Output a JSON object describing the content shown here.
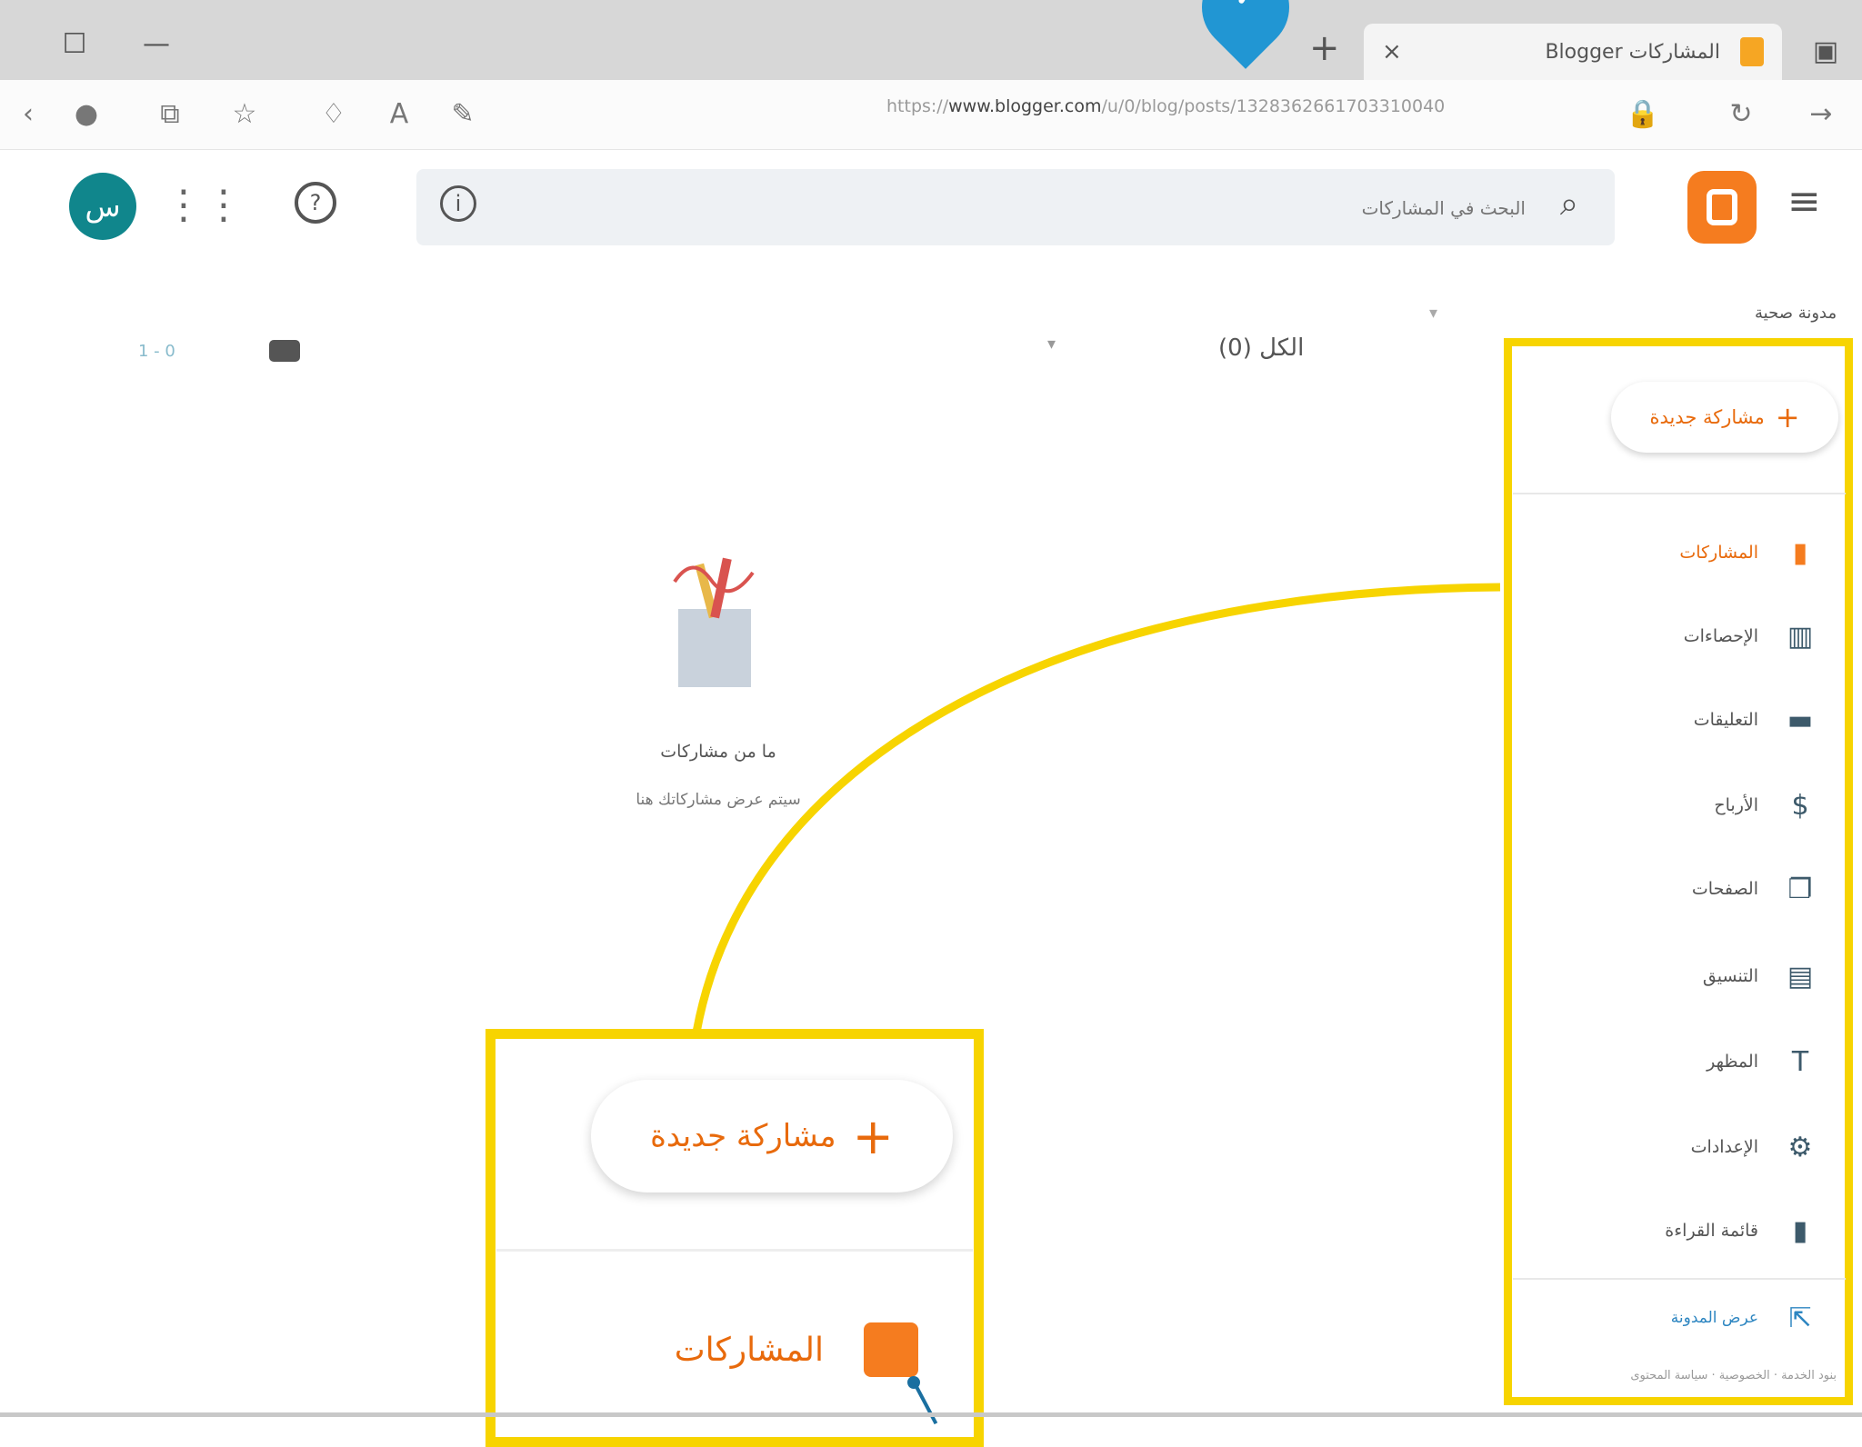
{
  "browser": {
    "tab_title": "المشاركات Blogger",
    "tab_close": "×",
    "new_tab": "+",
    "url_prefix": "https://",
    "url_domain": "www.blogger.com",
    "url_path": "/u/0/blog/posts/1328362661703310040",
    "minimize": "—",
    "restore": "☐"
  },
  "header": {
    "search_placeholder": "البحث في المشاركات",
    "avatar_letter": "س"
  },
  "content": {
    "blog_name": "مدونة صحية",
    "filter_all": "الكل (0)",
    "page_count": "1 - 0",
    "empty_title": "ما من مشاركات",
    "empty_subtitle": "سيتم عرض مشاركاتك هنا"
  },
  "sidebar": {
    "new_post_label": "مشاركة جديدة",
    "items": [
      {
        "label": "المشاركات",
        "icon": "posts-icon",
        "glyph": "▮"
      },
      {
        "label": "الإحصاءات",
        "icon": "stats-icon",
        "glyph": "📊"
      },
      {
        "label": "التعليقات",
        "icon": "comments-icon",
        "glyph": "▬"
      },
      {
        "label": "الأرباح",
        "icon": "earnings-icon",
        "glyph": "$"
      },
      {
        "label": "الصفحات",
        "icon": "pages-icon",
        "glyph": "❐"
      },
      {
        "label": "التنسيق",
        "icon": "layout-icon",
        "glyph": "▤"
      },
      {
        "label": "المظهر",
        "icon": "theme-icon",
        "glyph": "T"
      },
      {
        "label": "الإعدادات",
        "icon": "settings-icon",
        "glyph": "⚙"
      },
      {
        "label": "قائمة القراءة",
        "icon": "reading-list-icon",
        "glyph": "🔖"
      }
    ],
    "view_blog_label": "عرض المدونة",
    "footer": "بنود الخدمة · الخصوصية · سياسة المحتوى"
  },
  "zoom": {
    "new_post_label": "مشاركة جديدة",
    "posts_label": "المشاركات"
  },
  "colors": {
    "highlight": "#f7d400",
    "accent": "#e86a0c",
    "brand": "#f57c1f",
    "pin": "#2196d3"
  }
}
